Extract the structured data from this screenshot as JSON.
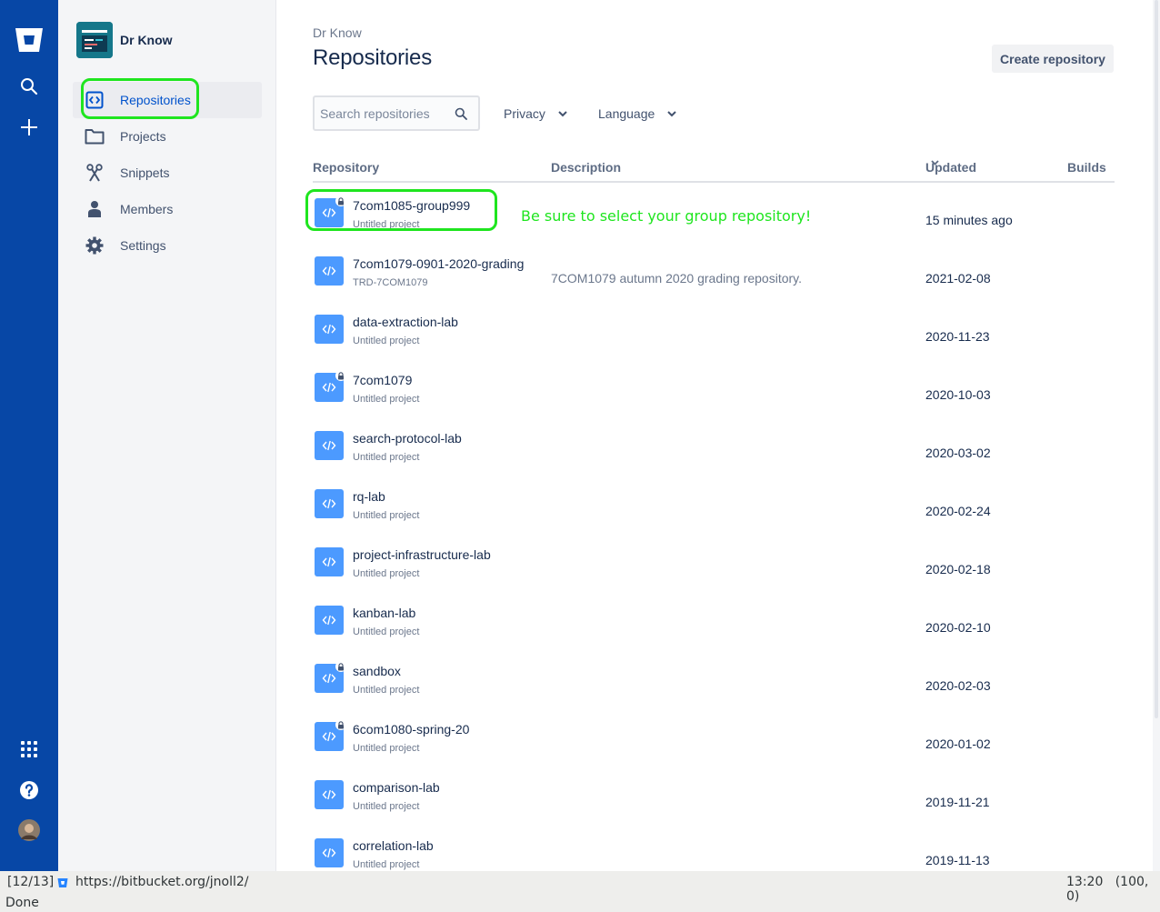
{
  "workspace": {
    "name": "Dr Know"
  },
  "sidebar": {
    "items": [
      {
        "label": "Repositories",
        "icon": "repositories-icon"
      },
      {
        "label": "Projects",
        "icon": "folder-icon"
      },
      {
        "label": "Snippets",
        "icon": "scissors-icon"
      },
      {
        "label": "Members",
        "icon": "person-icon"
      },
      {
        "label": "Settings",
        "icon": "gear-icon"
      }
    ]
  },
  "header": {
    "breadcrumb": "Dr Know",
    "title": "Repositories",
    "create_label": "Create repository"
  },
  "filters": {
    "search_placeholder": "Search repositories",
    "privacy_label": "Privacy",
    "language_label": "Language"
  },
  "table": {
    "columns": {
      "repository": "Repository",
      "description": "Description",
      "updated": "Updated",
      "builds": "Builds"
    },
    "rows": [
      {
        "name": "7com1085-group999",
        "project": "Untitled project",
        "description": "",
        "updated": "15 minutes ago",
        "private": true
      },
      {
        "name": "7com1079-0901-2020-grading",
        "project": "TRD-7COM1079",
        "description": "7COM1079 autumn 2020 grading repository.",
        "updated": "2021-02-08",
        "private": false
      },
      {
        "name": "data-extraction-lab",
        "project": "Untitled project",
        "description": "",
        "updated": "2020-11-23",
        "private": false
      },
      {
        "name": "7com1079",
        "project": "Untitled project",
        "description": "",
        "updated": "2020-10-03",
        "private": true
      },
      {
        "name": "search-protocol-lab",
        "project": "Untitled project",
        "description": "",
        "updated": "2020-03-02",
        "private": false
      },
      {
        "name": "rq-lab",
        "project": "Untitled project",
        "description": "",
        "updated": "2020-02-24",
        "private": false
      },
      {
        "name": "project-infrastructure-lab",
        "project": "Untitled project",
        "description": "",
        "updated": "2020-02-18",
        "private": false
      },
      {
        "name": "kanban-lab",
        "project": "Untitled project",
        "description": "",
        "updated": "2020-02-10",
        "private": false
      },
      {
        "name": "sandbox",
        "project": "Untitled project",
        "description": "",
        "updated": "2020-02-03",
        "private": true
      },
      {
        "name": "6com1080-spring-20",
        "project": "Untitled project",
        "description": "",
        "updated": "2020-01-02",
        "private": true
      },
      {
        "name": "comparison-lab",
        "project": "Untitled project",
        "description": "",
        "updated": "2019-11-21",
        "private": false
      },
      {
        "name": "correlation-lab",
        "project": "Untitled project",
        "description": "",
        "updated": "2019-11-13",
        "private": false
      }
    ]
  },
  "annotation": {
    "text": "Be sure to select your group repository!",
    "color": "#1fe51f"
  },
  "statusbar": {
    "position": "[12/13]",
    "url": "https://bitbucket.org/jnoll2/",
    "time": "13:20",
    "coords": "(100, 0)",
    "message": "Done"
  },
  "colors": {
    "global_nav": "#0747a6",
    "accent": "#0052cc",
    "repo_icon": "#4c9aff"
  }
}
